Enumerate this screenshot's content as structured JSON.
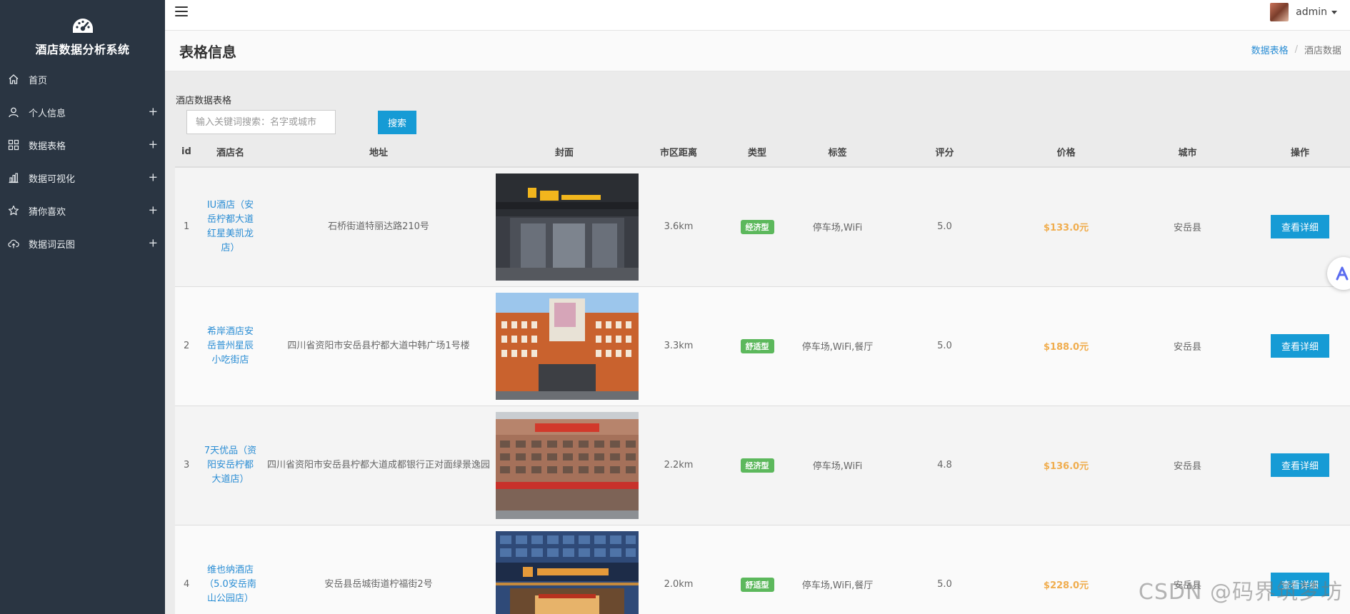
{
  "app": {
    "title": "酒店数据分析系统"
  },
  "sidebar": {
    "items": [
      {
        "label": "首页",
        "icon": "home-icon",
        "expandable": false
      },
      {
        "label": "个人信息",
        "icon": "user-icon",
        "expandable": true
      },
      {
        "label": "数据表格",
        "icon": "grid-icon",
        "expandable": true
      },
      {
        "label": "数据可视化",
        "icon": "bar-chart-icon",
        "expandable": true
      },
      {
        "label": "猜你喜欢",
        "icon": "star-icon",
        "expandable": true
      },
      {
        "label": "数据词云图",
        "icon": "cloud-upload-icon",
        "expandable": true
      }
    ],
    "plus_glyph": "+"
  },
  "topbar": {
    "username": "admin"
  },
  "page": {
    "title": "表格信息",
    "breadcrumb": {
      "link": "数据表格",
      "separator": "/",
      "current": "酒店数据"
    }
  },
  "table_section": {
    "label": "酒店数据表格",
    "search": {
      "placeholder": "输入关键词搜索：名字或城市",
      "value": "",
      "button": "搜索"
    },
    "columns": [
      "id",
      "酒店名",
      "地址",
      "封面",
      "市区距离",
      "类型",
      "标签",
      "评分",
      "价格",
      "城市",
      "操作"
    ],
    "rows": [
      {
        "id": "1",
        "name": "IU酒店（安岳柠都大道红星美凯龙店）",
        "address": "石桥街道特丽达路210号",
        "cover": "iu-hotel-facade",
        "distance": "3.6km",
        "type": "经济型",
        "tags": "停车场,WiFi",
        "rating": "5.0",
        "price": "$133.0元",
        "city": "安岳县",
        "action": "查看详细"
      },
      {
        "id": "2",
        "name": "希岸酒店安岳普州星辰小吃街店",
        "address": "四川省资阳市安岳县柠都大道中韩广场1号楼",
        "cover": "xian-hotel-facade",
        "distance": "3.3km",
        "type": "舒适型",
        "tags": "停车场,WiFi,餐厅",
        "rating": "5.0",
        "price": "$188.0元",
        "city": "安岳县",
        "action": "查看详细"
      },
      {
        "id": "3",
        "name": "7天优品（资阳安岳柠都大道店）",
        "address": "四川省资阳市安岳县柠都大道成都银行正对面绿景逸园",
        "cover": "7days-hotel-facade",
        "distance": "2.2km",
        "type": "经济型",
        "tags": "停车场,WiFi",
        "rating": "4.8",
        "price": "$136.0元",
        "city": "安岳县",
        "action": "查看详细"
      },
      {
        "id": "4",
        "name": "维也纳酒店（5.0安岳南山公园店）",
        "address": "安岳县岳城街道柠福街2号",
        "cover": "vienna-hotel-facade",
        "distance": "2.0km",
        "type": "舒适型",
        "tags": "停车场,WiFi,餐厅",
        "rating": "5.0",
        "price": "$228.0元",
        "city": "安岳县",
        "action": "查看详细"
      }
    ]
  },
  "watermark": "CSDN @码界筑梦坊",
  "colors": {
    "sidebar_bg": "#2a3542",
    "primary": "#169bd5",
    "link": "#2a8dd4",
    "badge_green": "#5cb85c",
    "price_orange": "#f0ad4e"
  }
}
